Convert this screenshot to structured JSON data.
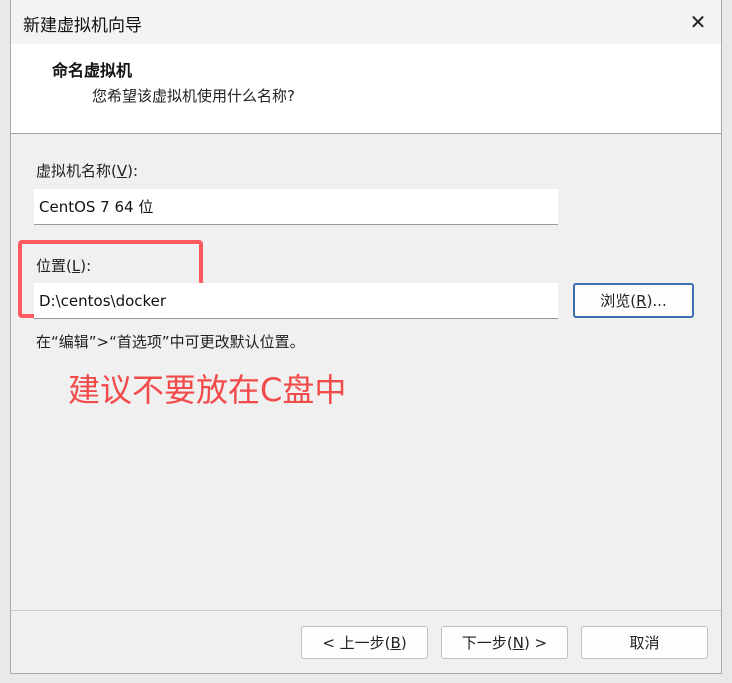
{
  "window": {
    "title": "新建虚拟机向导",
    "close_glyph": "✕"
  },
  "header": {
    "title": "命名虚拟机",
    "subtitle": "您希望该虚拟机使用什么名称?"
  },
  "vm_name": {
    "label_prefix": "虚拟机名称(",
    "label_key": "V",
    "label_suffix": "):",
    "value": "CentOS 7 64 位"
  },
  "location": {
    "label_prefix": "位置(",
    "label_key": "L",
    "label_suffix": "):",
    "value": "D:\\centos\\docker",
    "browse_prefix": "浏览(",
    "browse_key": "R",
    "browse_suffix": ")..."
  },
  "hint": "在“编辑”>“首选项”中可更改默认位置。",
  "annotation": {
    "note": "建议不要放在C盘中",
    "highlight_color": "#ff5a5f"
  },
  "buttons": {
    "back_prefix": "< 上一步(",
    "back_key": "B",
    "back_suffix": ")",
    "next_prefix": "下一步(",
    "next_key": "N",
    "next_suffix": ") >",
    "cancel": "取消"
  }
}
